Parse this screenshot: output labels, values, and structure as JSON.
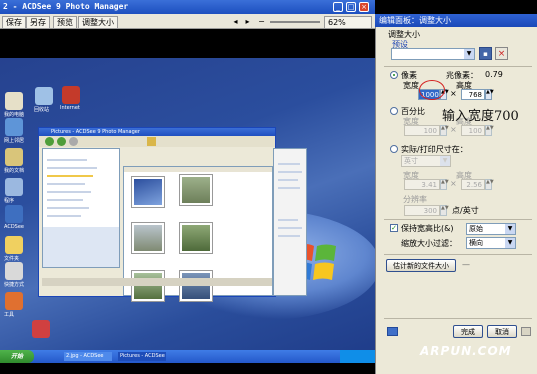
{
  "window": {
    "title": "2 - ACDSee 9 Photo Manager"
  },
  "toolbar": {
    "save": "保存",
    "save_as": "另存",
    "done": "完成",
    "preview": "预览",
    "resize": "调整大小",
    "zoom": "62%"
  },
  "desktop": {
    "icons": [
      "我的电脑",
      "回收站",
      "Internet",
      "网上邻居",
      "我的文档",
      "程序",
      "ACDSee",
      "文件夹",
      "快捷方式",
      "工具"
    ],
    "start_label": "开始",
    "task_items": [
      "2.jpg - ACDSee",
      "Pictures - ACDSee"
    ],
    "inner_title": "Pictures - ACDSee 9 Photo Manager",
    "inner_side_tabs": [
      "文件夹",
      "日历",
      "收藏夹",
      "预览",
      "属性",
      "整理",
      "类别"
    ]
  },
  "panel": {
    "title": "编辑面板：调整大小",
    "section": "调整大小",
    "preset_label": "预设",
    "preset_value": "",
    "pixels_label": "像素",
    "megapixels_label": "兆像素：",
    "megapixels_value": "0.79",
    "width_label": "宽度",
    "height_label": "高度",
    "width_value": "1000",
    "height_value": "768",
    "percent_label": "百分比",
    "pct_width_label": "宽度",
    "pct_height_label": "高度",
    "pct_width_value": "100",
    "pct_height_value": "100",
    "actual_label": "实际/打印尺寸在：",
    "unit_value": "英寸",
    "act_width_label": "宽度",
    "act_height_label": "高度",
    "act_width_value": "3.41",
    "act_height_value": "2.56",
    "resolution_label": "分辨率",
    "resolution_value": "300",
    "resolution_unit": "点/英寸",
    "keep_aspect_label": "保持宽高比(&)",
    "aspect_value": "原始",
    "filter_label": "缩放大小过滤：",
    "filter_value": "横向",
    "estimate_button": "估计新的文件大小",
    "done_button": "完成",
    "cancel_button": "取消"
  },
  "annotation": "输入宽度700",
  "watermark": "ARPUN.COM",
  "colors": {
    "title_blue": "#1d4fbf",
    "highlight_red": "#d42020",
    "xp_green": "#2f8a2c"
  }
}
